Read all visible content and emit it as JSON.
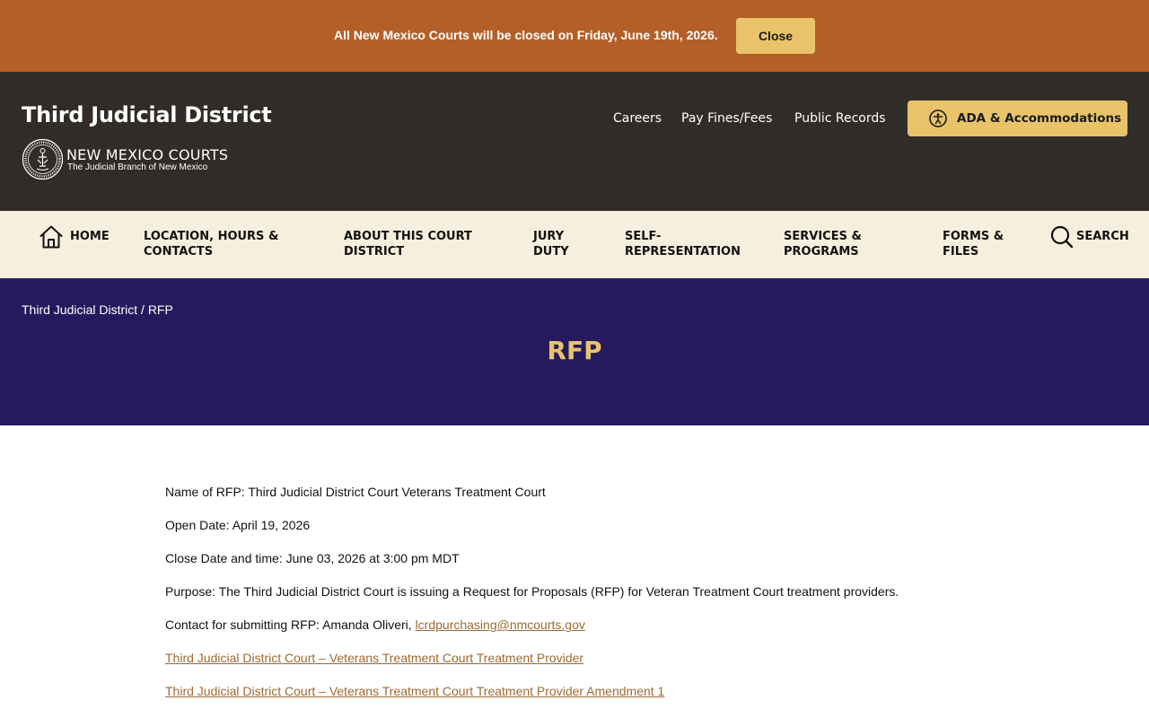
{
  "alert": {
    "message": "All New Mexico Courts will be closed on Friday, June 19th, 2026.",
    "close_label": "Close"
  },
  "header": {
    "site_title": "Third Judicial District",
    "brand_name": "NEW MEXICO COURTS",
    "brand_tagline": "The Judicial Branch of New Mexico",
    "links": [
      "Careers",
      "Pay Fines/Fees",
      "Public Records"
    ],
    "ada_label": "ADA & Accommodations",
    "ada_icon": "accessibility-icon"
  },
  "nav": {
    "home": "HOME",
    "items": [
      "LOCATION, HOURS & CONTACTS",
      "ABOUT THIS COURT DISTRICT",
      "JURY DUTY",
      "SELF-REPRESENTATION",
      "SERVICES & PROGRAMS",
      "FORMS & FILES"
    ],
    "search": "SEARCH",
    "home_icon": "home-icon",
    "search_icon": "search-icon"
  },
  "hero": {
    "breadcrumb_parent": "Third Judicial District",
    "breadcrumb_sep": "/",
    "breadcrumb_current": "RFP",
    "title": "RFP"
  },
  "content": {
    "name_line": "Name of RFP: Third Judicial District Court Veterans Treatment Court",
    "open_line": "Open Date: April 19, 2026",
    "close_line": "Close Date and time: June 03, 2026 at 3:00 pm MDT",
    "purpose_line": "Purpose: The Third Judicial District Court is issuing a Request for Proposals (RFP) for Veteran Treatment Court treatment providers.",
    "contact_prefix": "Contact for submitting RFP: Amanda Oliveri, ",
    "contact_email": "lcrdpurchasing@nmcourts.gov",
    "doc_link_1": "Third Judicial District Court – Veterans Treatment Court Treatment Provider",
    "doc_link_2": "Third Judicial District Court – Veterans Treatment Court Treatment Provider Amendment 1"
  },
  "colors": {
    "alert_bg": "#b45f27",
    "header_bg": "#302c27",
    "accent_gold": "#e8c36a",
    "nav_bg": "#f7efdd",
    "hero_bg": "#251a5e",
    "link": "#9c6a33"
  }
}
